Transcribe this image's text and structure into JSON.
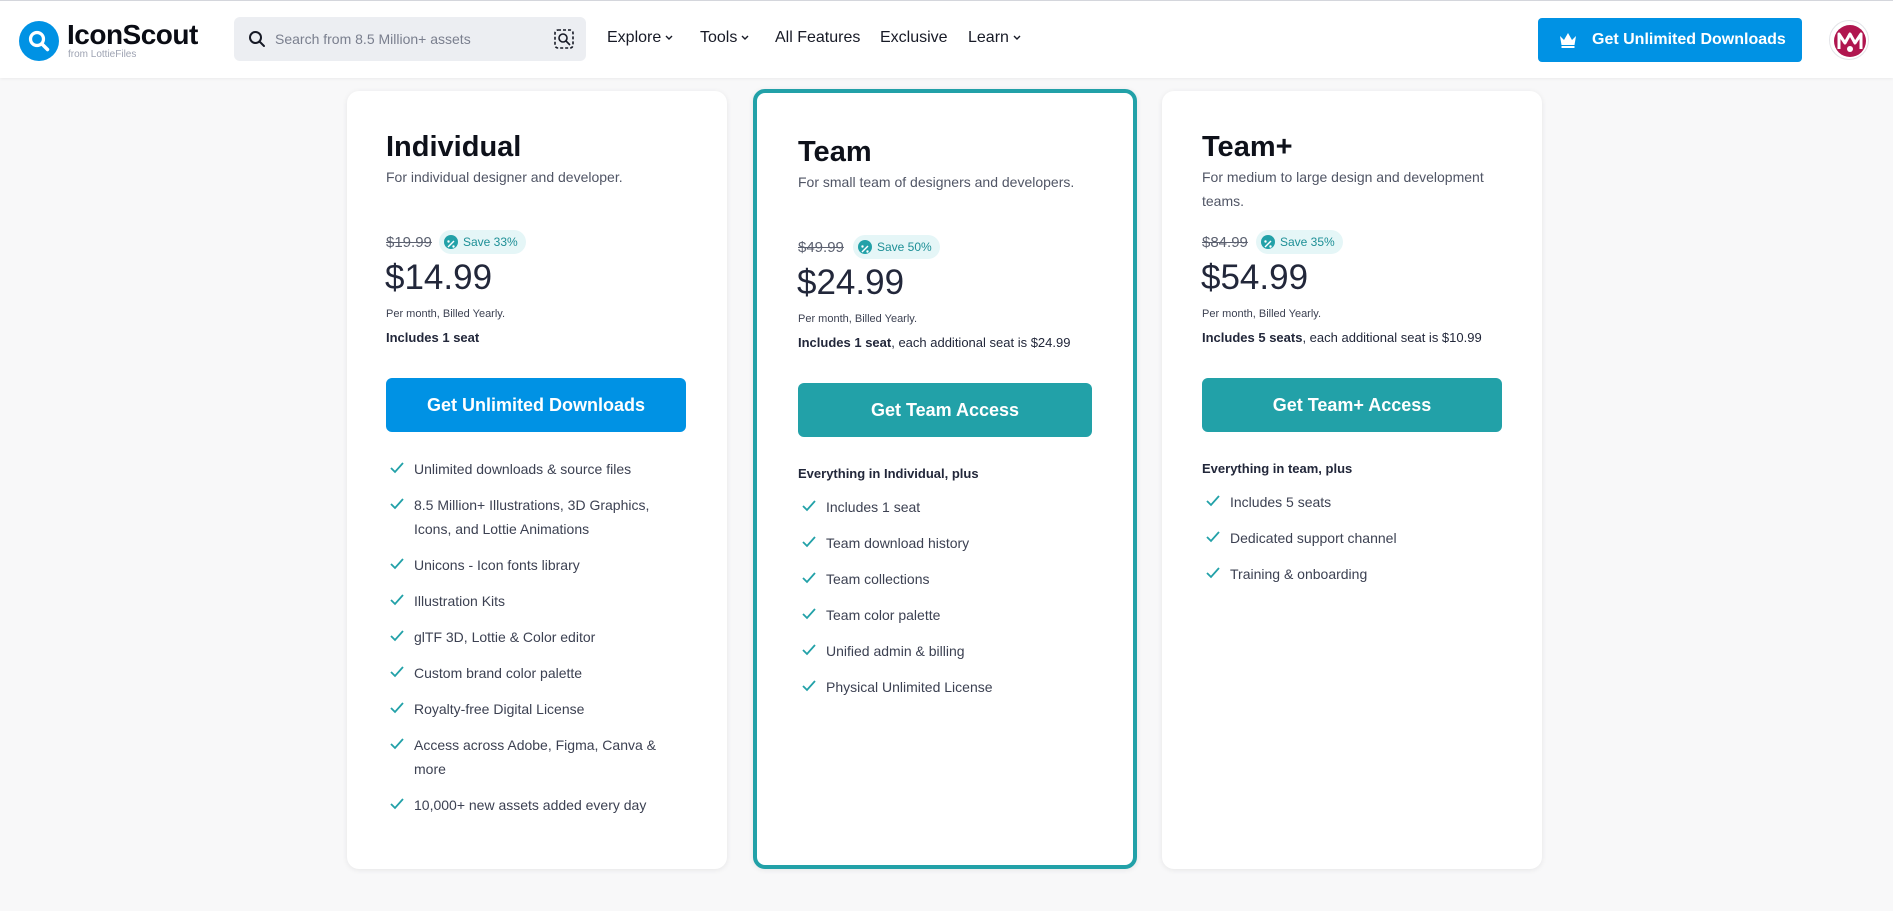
{
  "header": {
    "logo_text": "IconScout",
    "logo_sub": "from LottieFiles",
    "search_placeholder": "Search from 8.5 Million+ assets",
    "nav": [
      {
        "label": "Explore",
        "dropdown": true
      },
      {
        "label": "Tools",
        "dropdown": true
      },
      {
        "label": "All Features",
        "dropdown": false
      },
      {
        "label": "Exclusive",
        "dropdown": false
      },
      {
        "label": "Learn",
        "dropdown": true
      }
    ],
    "cta_label": "Get Unlimited Downloads"
  },
  "colors": {
    "brand_blue": "#0092e4",
    "teal": "#22a1a8",
    "avatar_magenta": "#b0164f"
  },
  "plans": [
    {
      "name": "Individual",
      "description": "For individual designer and developer.",
      "old_price": "$19.99",
      "save": "Save 33%",
      "price": "$14.99",
      "billing": "Per month, Billed Yearly.",
      "seats_bold": "Includes 1 seat",
      "seats_rest": "",
      "button": "Get Unlimited Downloads",
      "features_heading": "",
      "features": [
        "Unlimited downloads & source files",
        "8.5 Million+ Illustrations, 3D Graphics, Icons, and Lottie Animations",
        "Unicons - Icon fonts library",
        "Illustration Kits",
        "glTF 3D, Lottie & Color editor",
        "Custom brand color palette",
        "Royalty-free Digital License",
        "Access across Adobe, Figma, Canva & more",
        "10,000+ new assets added every day"
      ]
    },
    {
      "name": "Team",
      "description": "For small team of designers and developers.",
      "old_price": "$49.99",
      "save": "Save 50%",
      "price": "$24.99",
      "billing": "Per month, Billed Yearly.",
      "seats_bold": "Includes 1 seat",
      "seats_rest": ", each additional seat is $24.99",
      "button": "Get Team Access",
      "features_heading": "Everything in Individual, plus",
      "features": [
        "Includes 1 seat",
        "Team download history",
        "Team collections",
        "Team color palette",
        "Unified admin & billing",
        "Physical Unlimited License"
      ]
    },
    {
      "name": "Team+",
      "description": "For medium to large design and development teams.",
      "old_price": "$84.99",
      "save": "Save 35%",
      "price": "$54.99",
      "billing": "Per month, Billed Yearly.",
      "seats_bold": "Includes 5 seats",
      "seats_rest": ", each additional seat is $10.99",
      "button": "Get Team+ Access",
      "features_heading": "Everything in team, plus",
      "features": [
        "Includes 5 seats",
        "Dedicated support channel",
        "Training & onboarding"
      ]
    }
  ]
}
